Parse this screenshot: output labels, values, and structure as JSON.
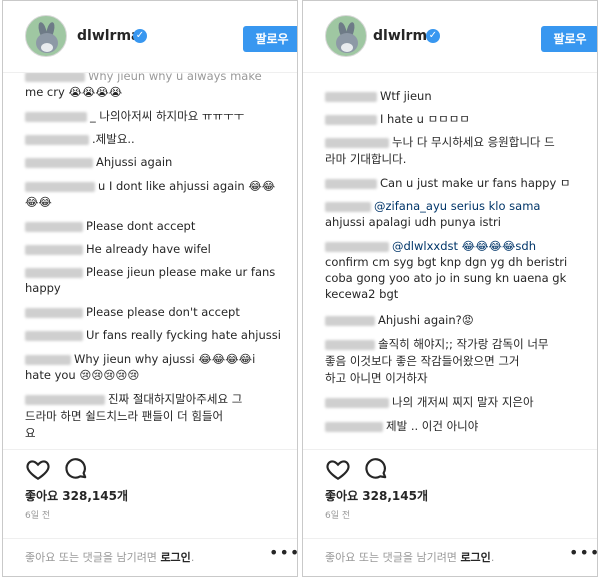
{
  "left": {
    "username": "dlwlrma",
    "follow_label": "팔로우",
    "comments": [
      {
        "prefix": "",
        "text": "Why jieun why u always make",
        "faded": true
      },
      {
        "prefix": "",
        "text": "me cry 😭😭😭😭"
      },
      {
        "prefix": "_",
        "text": "나의아저씨 하지마요 ㅠㅠㅜㅜ"
      },
      {
        "prefix": "",
        "text": ".제발요.."
      },
      {
        "prefix": "",
        "text": "Ahjussi again"
      },
      {
        "prefix": "",
        "text": "u I dont like ahjussi again 😂😂"
      },
      {
        "prefix": "",
        "text": "😂😂"
      },
      {
        "prefix": "",
        "text": "Please dont accept"
      },
      {
        "prefix": "",
        "text": "He already have wifel"
      },
      {
        "prefix": "",
        "text": "Please jieun please make ur fans"
      },
      {
        "prefix": "",
        "text": "happy"
      },
      {
        "prefix": "",
        "text": "Please please don't accept"
      },
      {
        "prefix": "",
        "text": "Ur fans really fycking hate ahjussi"
      },
      {
        "prefix": "",
        "text": "Why jieun why ajussi 😂😂😂😂i"
      },
      {
        "prefix": "",
        "text": "hate you 😢😢😢😢😢"
      },
      {
        "prefix": "",
        "text": "진짜 절대하지말아주세요 그"
      },
      {
        "prefix": "",
        "text": "드라마 하면 쉴드치느라 팬들이 더 힘들어"
      },
      {
        "prefix": "",
        "text": "요"
      }
    ],
    "likes": "좋아요 328,145개",
    "time": "6일 전",
    "footer_text": "좋아요 또는 댓글을 남기려면",
    "footer_link": "로그인",
    "footer_end": ".",
    "more": "•••"
  },
  "right": {
    "username": "dlwlrma",
    "follow_label": "팔로우",
    "comments": [
      {
        "prefix": "",
        "text": "Wtf jieun"
      },
      {
        "prefix": "",
        "text": "I hate u ㅁㅁㅁㅁ"
      },
      {
        "prefix": "",
        "text": "누나 다 무시하세요 응원합니다 드"
      },
      {
        "prefix": "",
        "text": "라마 기대합니다."
      },
      {
        "prefix": "",
        "text": "Can u just make ur fans happy ㅁ"
      },
      {
        "prefix": "",
        "text": "@zifana_ayu serius klo sama"
      },
      {
        "prefix": "",
        "text": "ahjussi apalagi udh punya istri"
      },
      {
        "prefix": "",
        "text": "@dlwlxxdst 😂😂😂😂sdh"
      },
      {
        "prefix": "",
        "text": "confirm cm syg bgt knp dgn yg dh beristri"
      },
      {
        "prefix": "",
        "text": "coba gong yoo ato jo in sung kn uaena gk"
      },
      {
        "prefix": "",
        "text": "kecewa2 bgt"
      },
      {
        "prefix": "",
        "text": "Ahjushi again?😡"
      },
      {
        "prefix": "",
        "text": "솔직히 해야지;; 작가랑 감독이 너무"
      },
      {
        "prefix": "",
        "text": "좋음 이것보다 좋은 작감들어왔으면 그거"
      },
      {
        "prefix": "",
        "text": "하고 아니면 이거하자"
      },
      {
        "prefix": "",
        "text": "나의 개저씨 찌지 말자 지은아"
      },
      {
        "prefix": "",
        "text": "제발 .. 이건 아니야"
      }
    ],
    "likes": "좋아요 328,145개",
    "time": "6일 전",
    "footer_text": "좋아요 또는 댓글을 남기려면",
    "footer_link": "로그인",
    "footer_end": ".",
    "more": "•••"
  }
}
